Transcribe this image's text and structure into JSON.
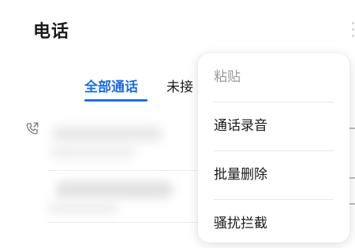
{
  "header": {
    "title": "电话",
    "more_icon": "more-vertical-icon"
  },
  "tabs": [
    {
      "label": "全部通话",
      "selected": true
    },
    {
      "label": "未接",
      "selected": false
    }
  ],
  "colors": {
    "accent": "#1f6fd6",
    "text": "#1a1a1a",
    "disabled_text": "#9b9b9b"
  },
  "call_log": {
    "call_type_icon": "outgoing-call-icon",
    "rows": [
      {
        "content": ""
      },
      {
        "content": ""
      }
    ]
  },
  "context_menu": {
    "items": [
      {
        "label": "粘贴",
        "enabled": false
      },
      {
        "label": "通话录音",
        "enabled": true
      },
      {
        "label": "批量删除",
        "enabled": true
      },
      {
        "label": "骚扰拦截",
        "enabled": true
      }
    ]
  }
}
